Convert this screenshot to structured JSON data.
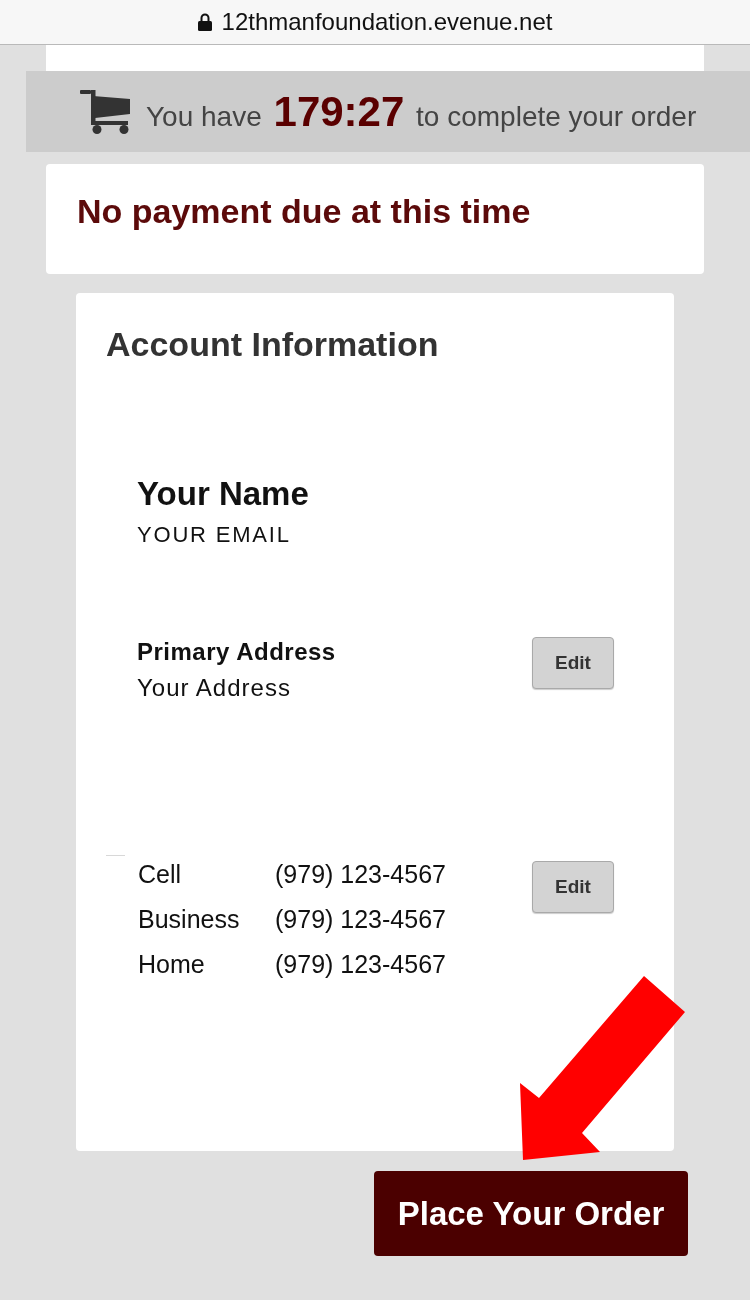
{
  "browser": {
    "url": "12thmanfoundation.evenue.net"
  },
  "timer": {
    "text": "You have **179:27** to complete your order"
  },
  "payment_notice": {
    "message": "No payment due at this time"
  },
  "account": {
    "title": "Account Information",
    "name": "Your Name",
    "email": "YOUR EMAIL",
    "address": {
      "label": "Primary Address",
      "value": "Your Address",
      "edit_button": "Edit"
    },
    "phones": {
      "rows": [
        {
          "type": "Cell",
          "number": "(979) 123-4567"
        },
        {
          "type": "Business",
          "number": "(979) 123-4567"
        },
        {
          "type": "Home",
          "number": "(979) 123-4567"
        }
      ],
      "edit_button": "Edit"
    }
  },
  "place_order_button": "Place Your Order"
}
